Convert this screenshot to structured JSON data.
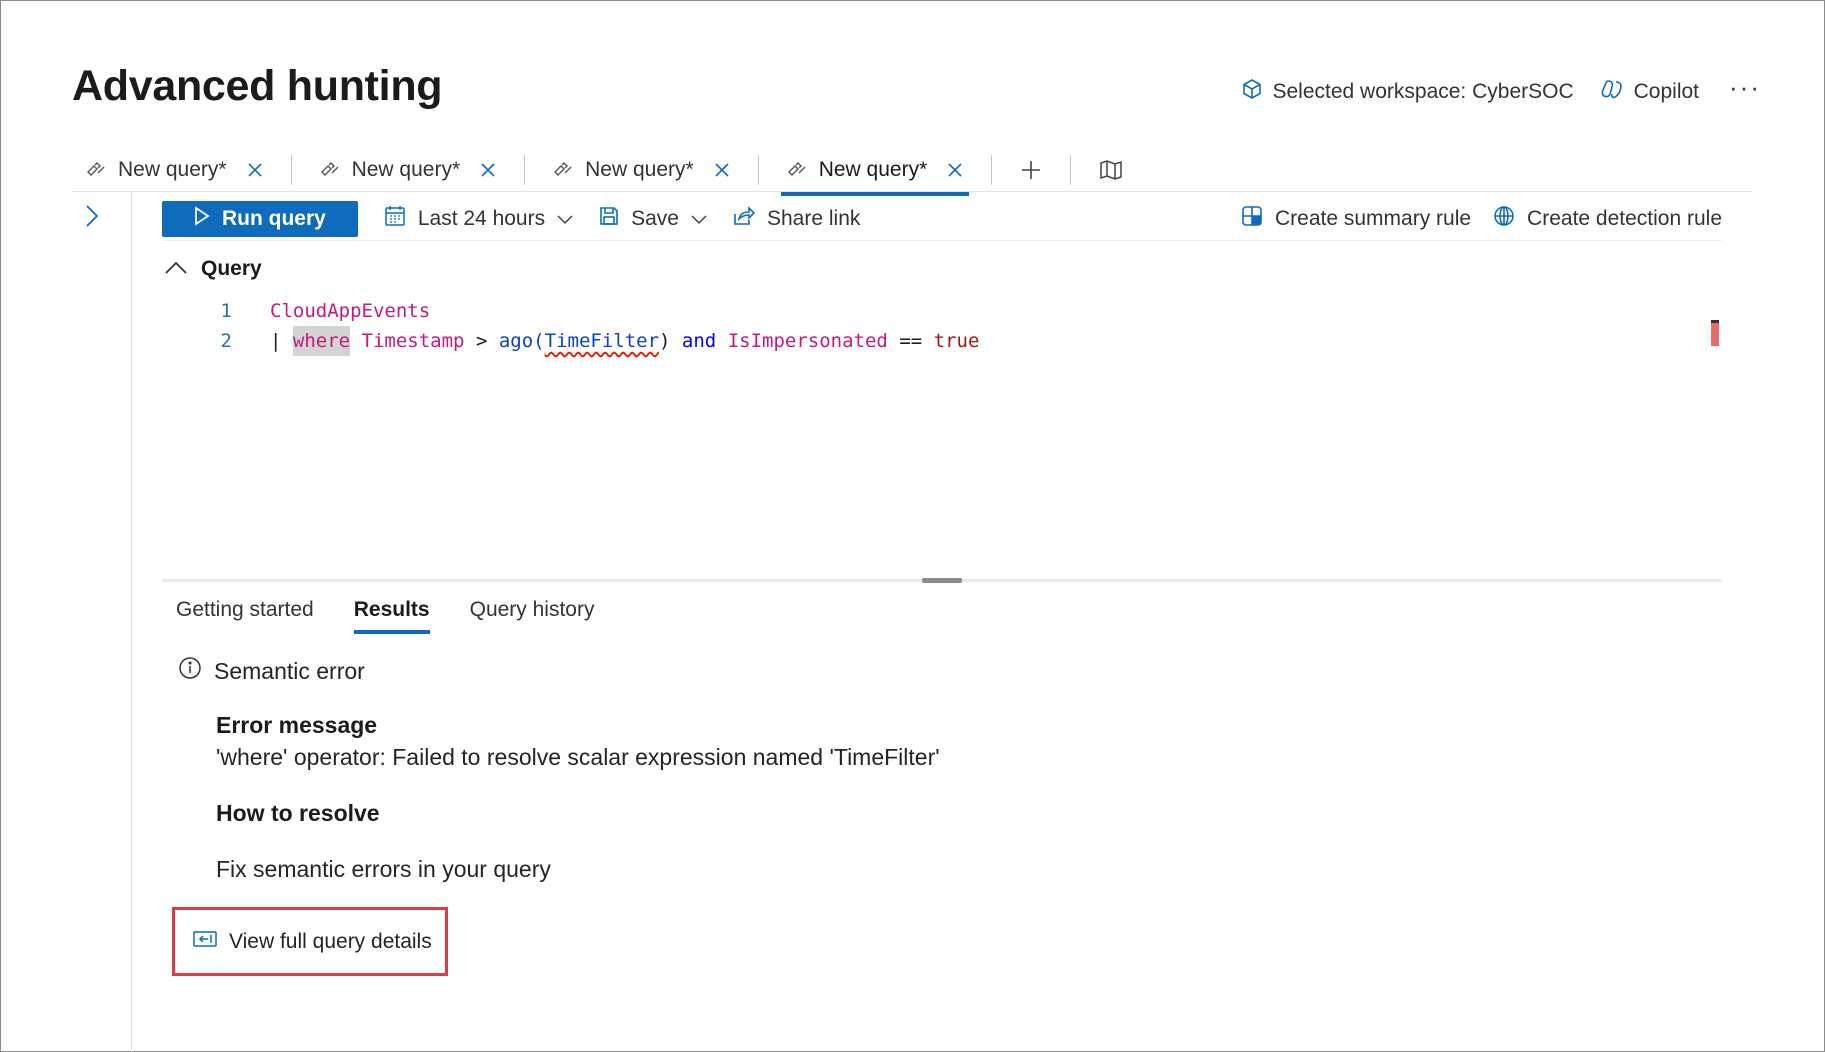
{
  "page": {
    "title": "Advanced hunting"
  },
  "header": {
    "workspace_label": "Selected workspace: CyberSOC",
    "copilot_label": "Copilot",
    "more_label": "···"
  },
  "tabs": [
    {
      "label": "New query*",
      "active": false
    },
    {
      "label": "New query*",
      "active": false
    },
    {
      "label": "New query*",
      "active": false
    },
    {
      "label": "New query*",
      "active": true
    }
  ],
  "toolbar": {
    "run_label": "Run query",
    "time_range": "Last 24 hours",
    "save_label": "Save",
    "share_label": "Share link",
    "summary_rule_label": "Create summary rule",
    "detection_rule_label": "Create detection rule"
  },
  "editor": {
    "section_label": "Query",
    "lines": [
      {
        "number": "1",
        "table": "CloudAppEvents"
      },
      {
        "number": "2",
        "pipe": "| ",
        "where": "where",
        "column": "Timestamp",
        "gt": ">",
        "fn": "ago(",
        "arg": "TimeFilter",
        "close": ")",
        "and": "and",
        "field": "IsImpersonated",
        "eq": "==",
        "value": "true"
      }
    ]
  },
  "results_tabs": [
    {
      "label": "Getting started",
      "active": false
    },
    {
      "label": "Results",
      "active": true
    },
    {
      "label": "Query history",
      "active": false
    }
  ],
  "error": {
    "type": "Semantic error",
    "message_title": "Error message",
    "message": "'where' operator: Failed to resolve scalar expression named 'TimeFilter'",
    "resolve_title": "How to resolve",
    "resolve_text": "Fix semantic errors in your query",
    "details_link": "View full query details"
  },
  "icons": {
    "workspace": "cube-icon",
    "copilot": "copilot-icon",
    "tab": "query-pen-icon",
    "close": "close-icon",
    "add": "plus-icon",
    "map": "book-map-icon",
    "run": "play-icon",
    "calendar": "calendar-icon",
    "save": "save-icon",
    "share": "share-icon",
    "summary": "summary-rule-icon",
    "detection": "detection-rule-icon",
    "info": "info-icon",
    "details": "open-panel-icon"
  },
  "colors": {
    "accent": "#0f6cbd",
    "highlight_border": "#e03a44"
  }
}
